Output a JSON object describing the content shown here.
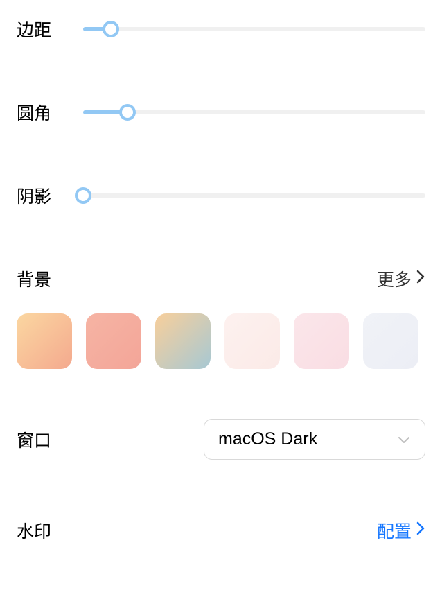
{
  "sliders": {
    "margin": {
      "label": "边距",
      "value": 8,
      "max": 100
    },
    "radius": {
      "label": "圆角",
      "value": 13,
      "max": 100
    },
    "shadow": {
      "label": "阴影",
      "value": 0,
      "max": 100
    }
  },
  "background": {
    "label": "背景",
    "more": "更多",
    "swatches": [
      {
        "css": "linear-gradient(135deg, #fbd7a1, #f4a98e)"
      },
      {
        "css": "linear-gradient(135deg, #f6b4a4, #f3a598)"
      },
      {
        "css": "linear-gradient(135deg, #f8cf9b, #a7c8d3)"
      },
      {
        "css": "linear-gradient(135deg, #fdf1ef, #fbeae7)"
      },
      {
        "css": "linear-gradient(135deg, #fbe6ea, #f9dde3)"
      },
      {
        "css": "linear-gradient(135deg, #f0f2f7, #eceef5)"
      }
    ]
  },
  "window": {
    "label": "窗口",
    "selected": "macOS Dark"
  },
  "watermark": {
    "label": "水印",
    "configure": "配置"
  },
  "colors": {
    "accent": "#92c8f4",
    "link": "#1677ff"
  }
}
